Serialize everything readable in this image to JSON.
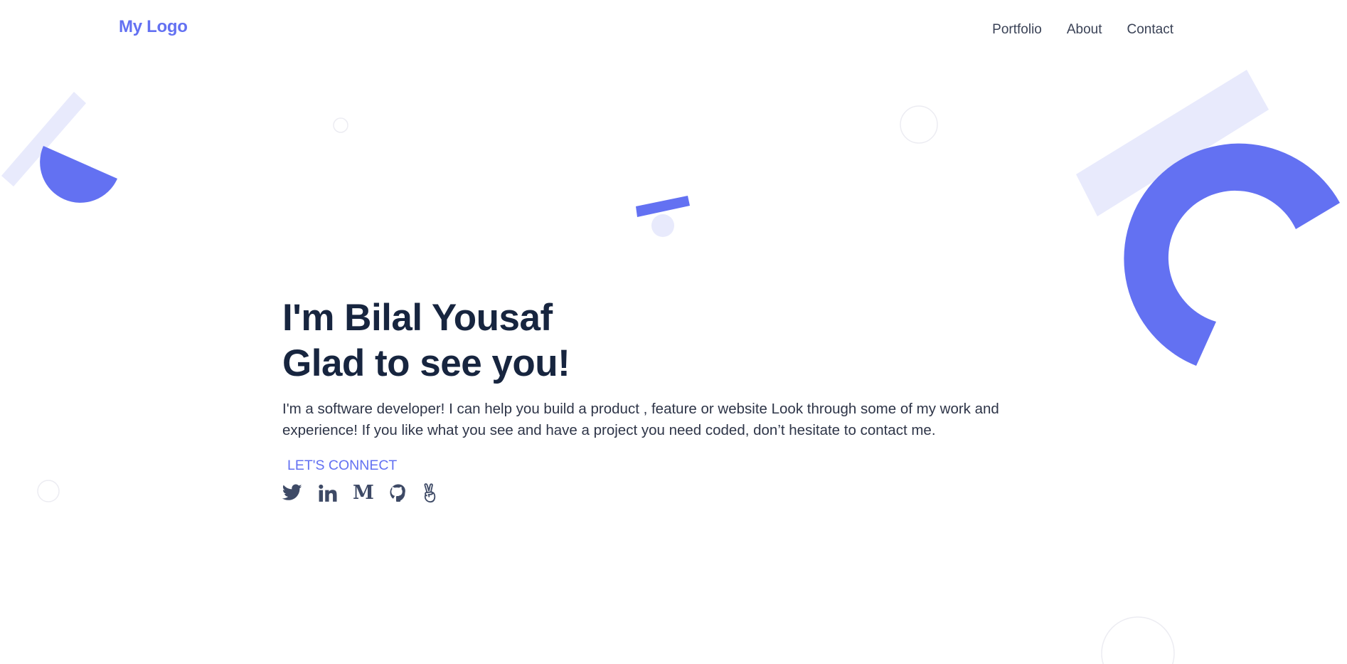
{
  "header": {
    "logo": "My Logo",
    "nav": [
      "Portfolio",
      "About",
      "Contact"
    ]
  },
  "hero": {
    "line1": "I'm Bilal Yousaf",
    "line2": "Glad to see you!",
    "description": "I'm a software developer! I can help you build a product , feature or website Look through some of my work and experience! If you like what you see and have a project you need coded, don’t hesitate to contact me.",
    "cta": "LET'S CONNECT",
    "medium_glyph": "M"
  },
  "social_icons": [
    "twitter-icon",
    "linkedin-icon",
    "medium-icon",
    "github-icon",
    "angellist-icon"
  ],
  "colors": {
    "accent": "#6371f2",
    "accent_light": "#e8eafc",
    "heading": "#17253f",
    "body_text": "#2e3548",
    "nav_text": "#3a4256",
    "icon": "#3e4a66",
    "circle_outline": "#ececf2"
  }
}
